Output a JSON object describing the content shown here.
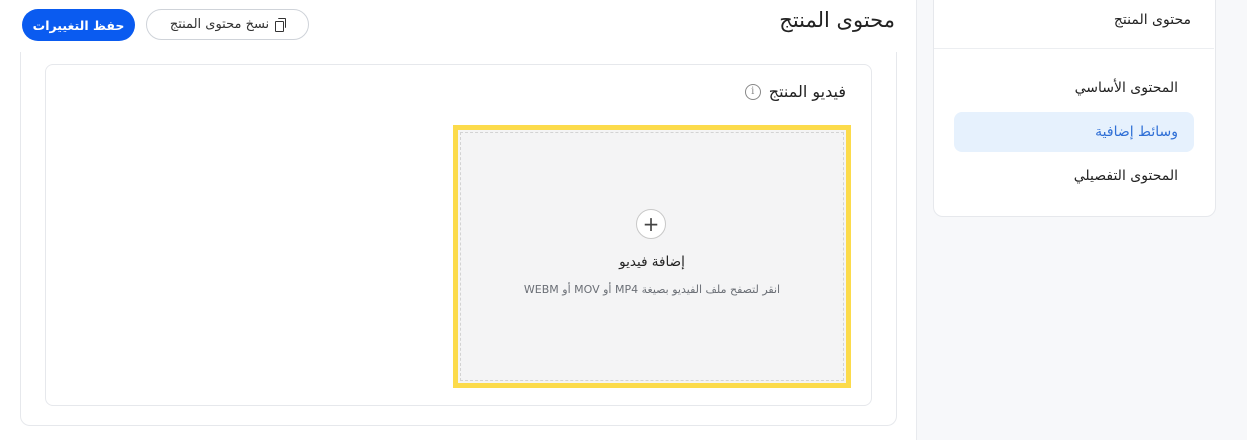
{
  "header": {
    "title": "محتوى المنتج",
    "save_label": "حفظ التغييرات",
    "copy_label": "نسخ محتوى المنتج"
  },
  "sidebar": {
    "title": "محتوى المنتج",
    "items": [
      {
        "label": "المحتوى الأساسي",
        "active": false
      },
      {
        "label": "وسائط إضافية",
        "active": true
      },
      {
        "label": "المحتوى التفصيلي",
        "active": false
      }
    ]
  },
  "video_section": {
    "title": "فيديو المنتج",
    "info_icon_glyph": "i",
    "upload": {
      "plus_glyph": "+",
      "label": "إضافة فيديو",
      "hint": "انقر لتصفح ملف الفيديو بصيغة MP4 أو MOV أو WEBM"
    }
  },
  "colors": {
    "primary": "#0a5bf0",
    "active_bg": "#e6f1fd",
    "active_text": "#2f6fd6",
    "dropzone_border": "#fcdb4b"
  }
}
